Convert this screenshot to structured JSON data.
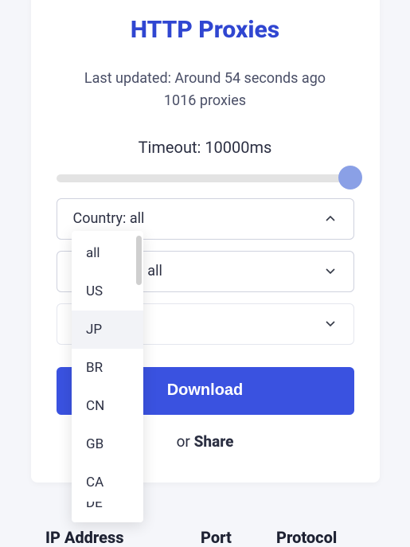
{
  "title": "HTTP Proxies",
  "updated_line": "Last updated: Around 54 seconds ago",
  "count_line": "1016 proxies",
  "timeout_label": "Timeout: 10000ms",
  "slider": {
    "value": 10000,
    "min": 0,
    "max": 10000
  },
  "country_select": {
    "label": "Country: all",
    "open": true,
    "options": [
      "all",
      "US",
      "JP",
      "BR",
      "CN",
      "GB",
      "CA",
      "DE"
    ],
    "hovered": "JP"
  },
  "anonymity_select": {
    "label": "Anonymity: all"
  },
  "third_select": {
    "label": ""
  },
  "download_label": "Download",
  "share_prefix": "or ",
  "share_link": "Share",
  "table_headers": {
    "ip": "IP Address",
    "port": "Port",
    "protocol": "Protocol"
  }
}
